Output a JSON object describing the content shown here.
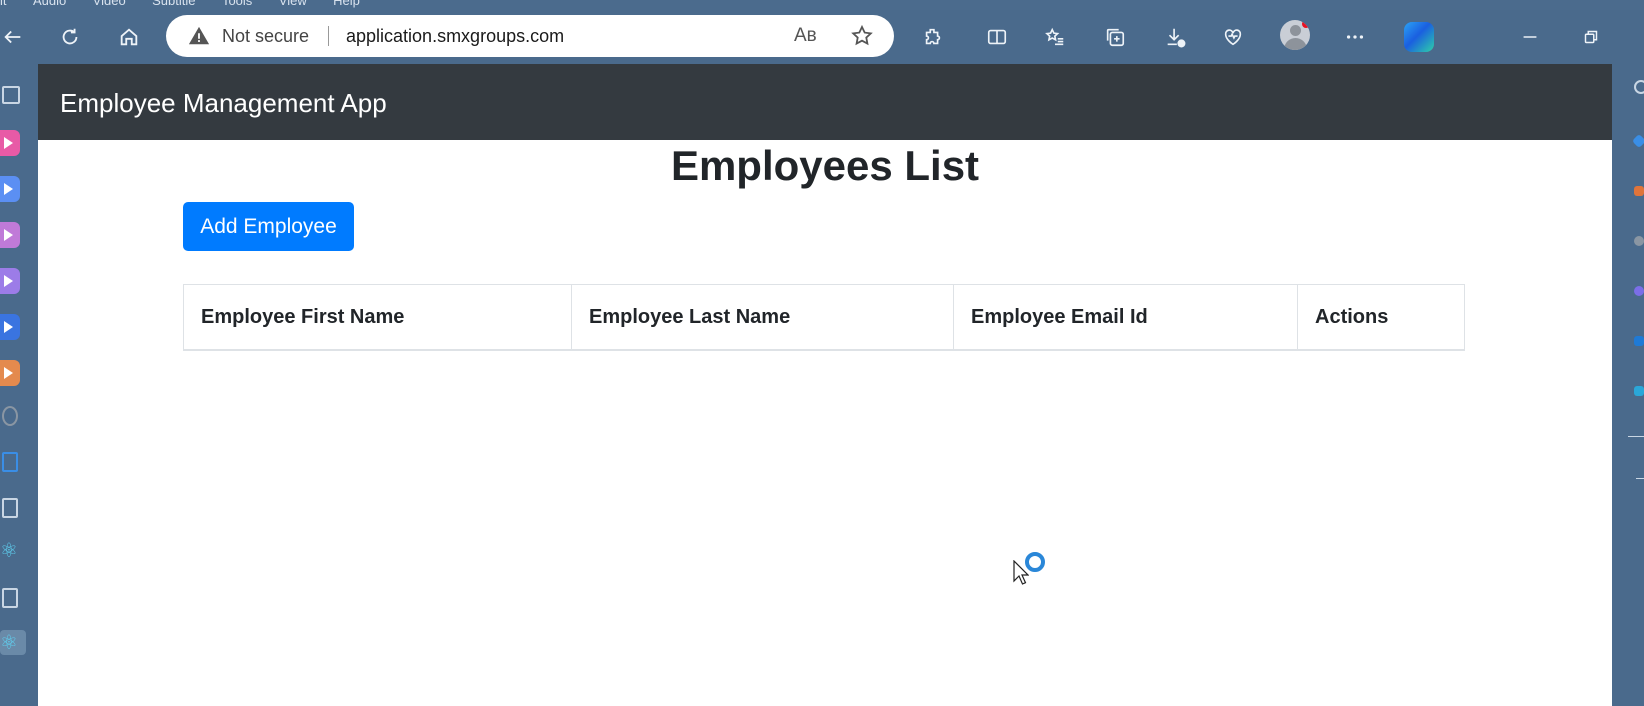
{
  "browser": {
    "menu": [
      "it",
      "Audio",
      "Video",
      "Subtitle",
      "Tools",
      "View",
      "Help"
    ],
    "address": {
      "security_label": "Not secure",
      "url": "application.smxgroups.com",
      "read_aloud_glyph": "Aʙ"
    }
  },
  "app": {
    "brand": "Employee Management App",
    "page_title": "Employees List",
    "add_button": "Add Employee",
    "table": {
      "headers": [
        "Employee First Name",
        "Employee Last Name",
        "Employee Email Id",
        "Actions"
      ],
      "rows": []
    }
  },
  "colors": {
    "navbar": "#343a40",
    "primary_button": "#007bff",
    "browser_chrome": "#4a6a8c"
  }
}
